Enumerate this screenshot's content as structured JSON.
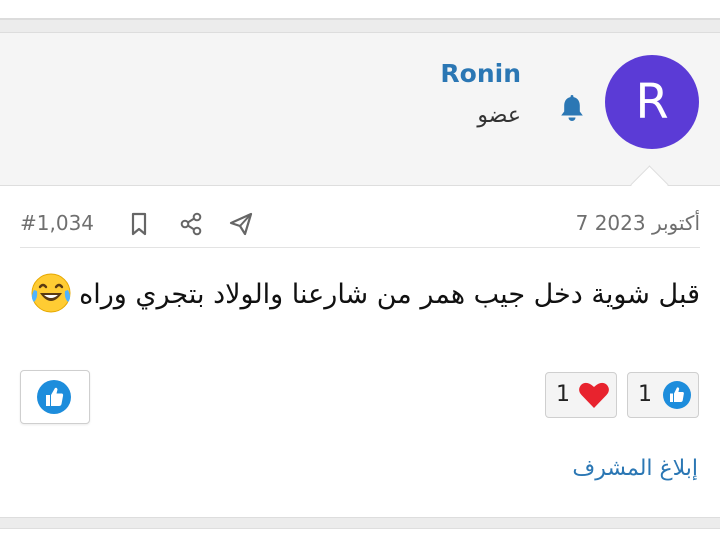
{
  "user": {
    "avatar_letter": "R",
    "avatar_color": "#5b3bd6",
    "name": "Ronin",
    "role": "عضو",
    "notification_icon": "bell-icon"
  },
  "post": {
    "date": "7 أكتوبر 2023",
    "number": "#1,034",
    "actions": [
      "share-telegram-icon",
      "share-icon",
      "bookmark-icon"
    ],
    "body_text": "قبل شوية دخل جيب همر من شارعنا والولاد بتجري وراه",
    "body_emoji": "laughing-tears-emoji"
  },
  "reactions": [
    {
      "type": "like",
      "icon": "like-icon",
      "count": "1"
    },
    {
      "type": "love",
      "icon": "heart-icon",
      "count": "1"
    }
  ],
  "like_button": {
    "icon": "like-icon"
  },
  "report_link": "إبلاغ المشرف",
  "colors": {
    "link": "#2b77b4",
    "like_blue": "#1d8ddc",
    "heart_red": "#e8232e"
  }
}
